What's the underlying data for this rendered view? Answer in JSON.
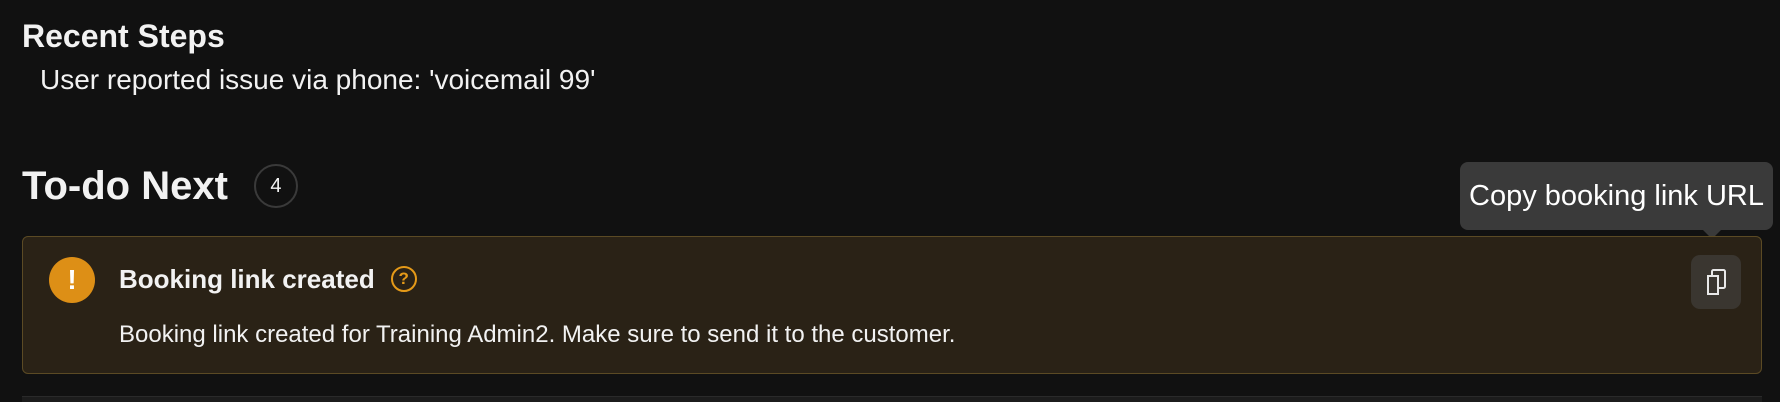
{
  "recent_steps": {
    "title": "Recent Steps",
    "items": [
      "User reported issue via phone: 'voicemail 99'"
    ]
  },
  "todo": {
    "title": "To-do Next",
    "count": "4",
    "tooltip": "Copy booking link URL",
    "cards": [
      {
        "title": "Booking link created",
        "description": "Booking link created for Training Admin2. Make sure to send it to the customer.",
        "icon": "warning-icon",
        "help_icon": "help-icon",
        "action_icon": "copy-icon"
      }
    ]
  },
  "colors": {
    "background": "#111111",
    "card_background": "#2a2216",
    "card_border": "#5b4a24",
    "warning": "#dd8f16",
    "help": "#e59a18",
    "tooltip": "#3a3a3a"
  }
}
